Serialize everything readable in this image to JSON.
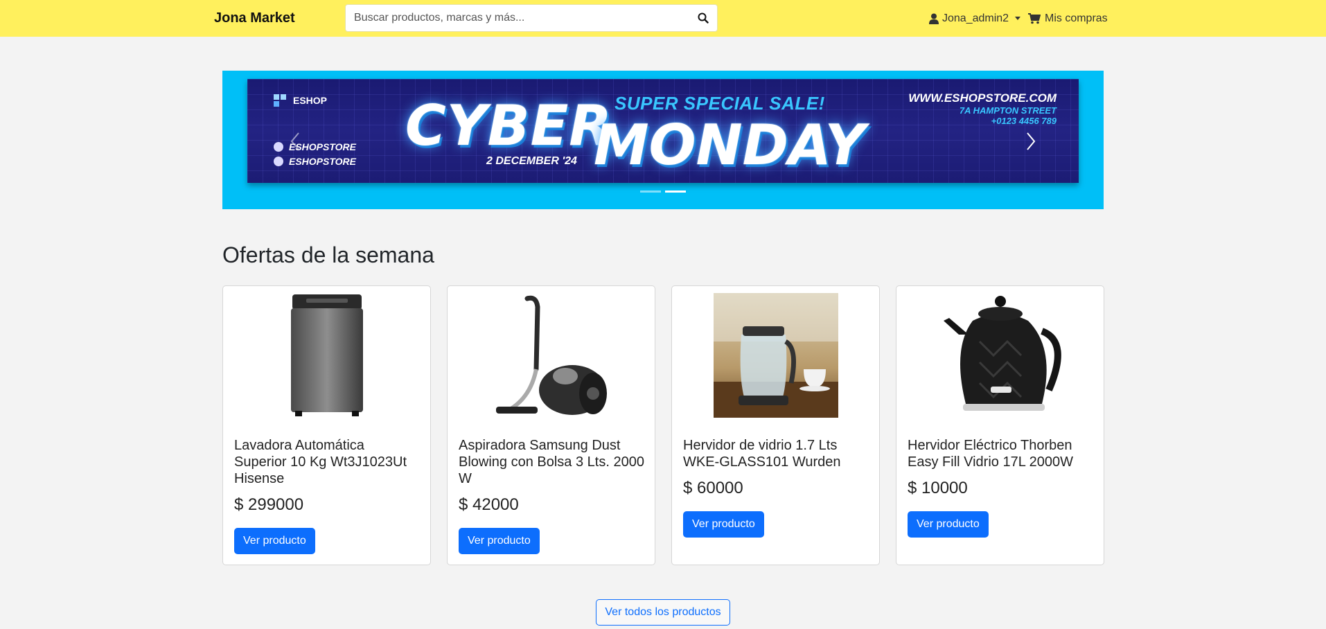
{
  "navbar": {
    "brand": "Jona Market",
    "search_placeholder": "Buscar productos, marcas y más...",
    "search_icon": "search-icon",
    "user_label": "Jona_admin2",
    "user_icon": "user-icon",
    "cart_label": "Mis compras",
    "cart_icon": "cart-icon",
    "background": "#fff05d"
  },
  "carousel": {
    "background": "#00bff7",
    "banner": {
      "logo": "ESHOP",
      "social_1": "ESHOPSTORE",
      "social_2": "ESHOPSTORE",
      "cyber": "CYBER",
      "date": "2 DECEMBER '24",
      "super": "SUPER SPECIAL SALE!",
      "monday": "MONDAY",
      "website": "WWW.ESHOPSTORE.COM",
      "address": "7A HAMPTON STREET",
      "phone": "+0123 4456 789"
    },
    "slides": 2,
    "active_slide": 2
  },
  "offers": {
    "title": "Ofertas de la semana",
    "button_label": "Ver producto",
    "products": [
      {
        "name": "Lavadora Automática Superior 10 Kg Wt3J1023Ut Hisense",
        "price": "$ 299000"
      },
      {
        "name": "Aspiradora Samsung Dust Blowing con Bolsa 3 Lts. 2000 W",
        "price": "$ 42000"
      },
      {
        "name": "Hervidor de vidrio 1.7 Lts WKE-GLASS101 Wurden",
        "price": "$ 60000"
      },
      {
        "name": "Hervidor Eléctrico Thorben Easy Fill Vidrio 17L 2000W",
        "price": "$ 10000"
      }
    ]
  },
  "all_products_label": "Ver todos los productos",
  "accent": "#0d6efd"
}
